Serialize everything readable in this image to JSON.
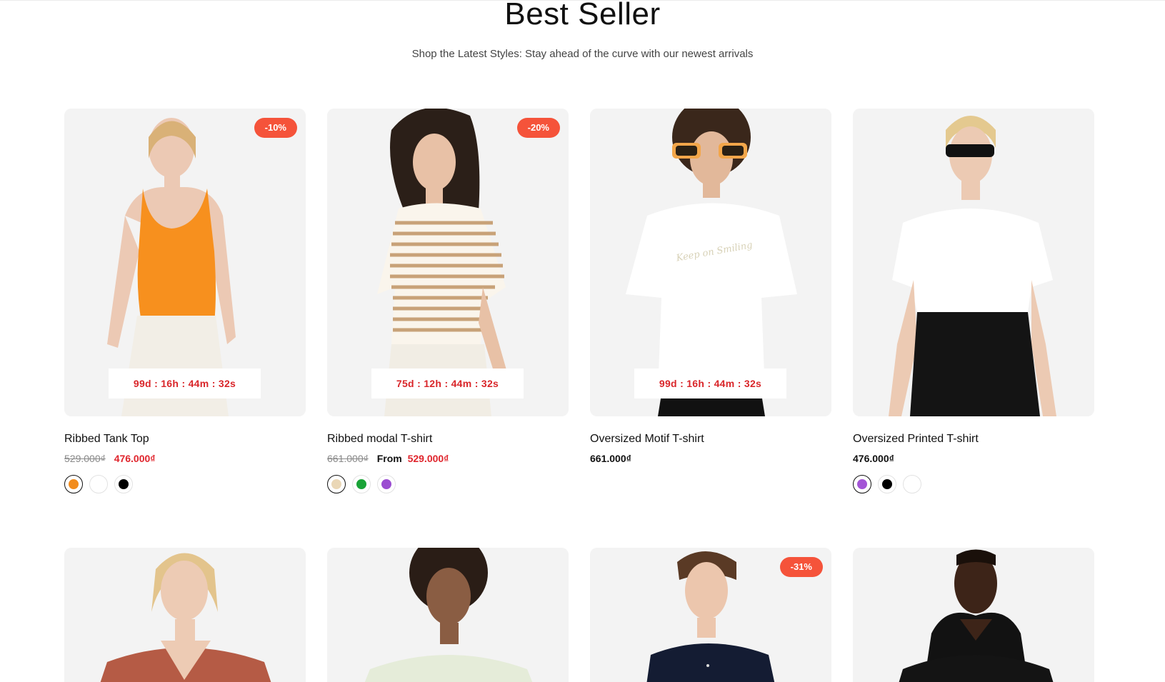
{
  "header": {
    "title": "Best Seller",
    "subtitle": "Shop the Latest Styles: Stay ahead of the curve with our newest arrivals"
  },
  "products": [
    {
      "name": "Ribbed Tank Top",
      "badge": "-10%",
      "countdown": "99d : 16h : 44m : 32s",
      "price_old": "529.000₫",
      "price_sale": "476.000₫",
      "swatches": [
        "#f28c1c",
        "#ffffff",
        "#000000"
      ]
    },
    {
      "name": "Ribbed modal T-shirt",
      "badge": "-20%",
      "countdown": "75d : 12h : 44m : 32s",
      "price_old": "661.000₫",
      "price_from_label": "From",
      "price_sale": "529.000₫",
      "swatches": [
        "#ead7b6",
        "#19a337",
        "#9b4dd1"
      ]
    },
    {
      "name": "Oversized Motif T-shirt",
      "countdown": "99d : 16h : 44m : 32s",
      "price": "661.000₫"
    },
    {
      "name": "Oversized Printed T-shirt",
      "price": "476.000₫",
      "swatches": [
        "#a355d6",
        "#000000",
        "#ffffff"
      ]
    },
    {
      "name": ""
    },
    {
      "name": ""
    },
    {
      "name": "",
      "badge": "-31%"
    },
    {
      "name": ""
    }
  ]
}
